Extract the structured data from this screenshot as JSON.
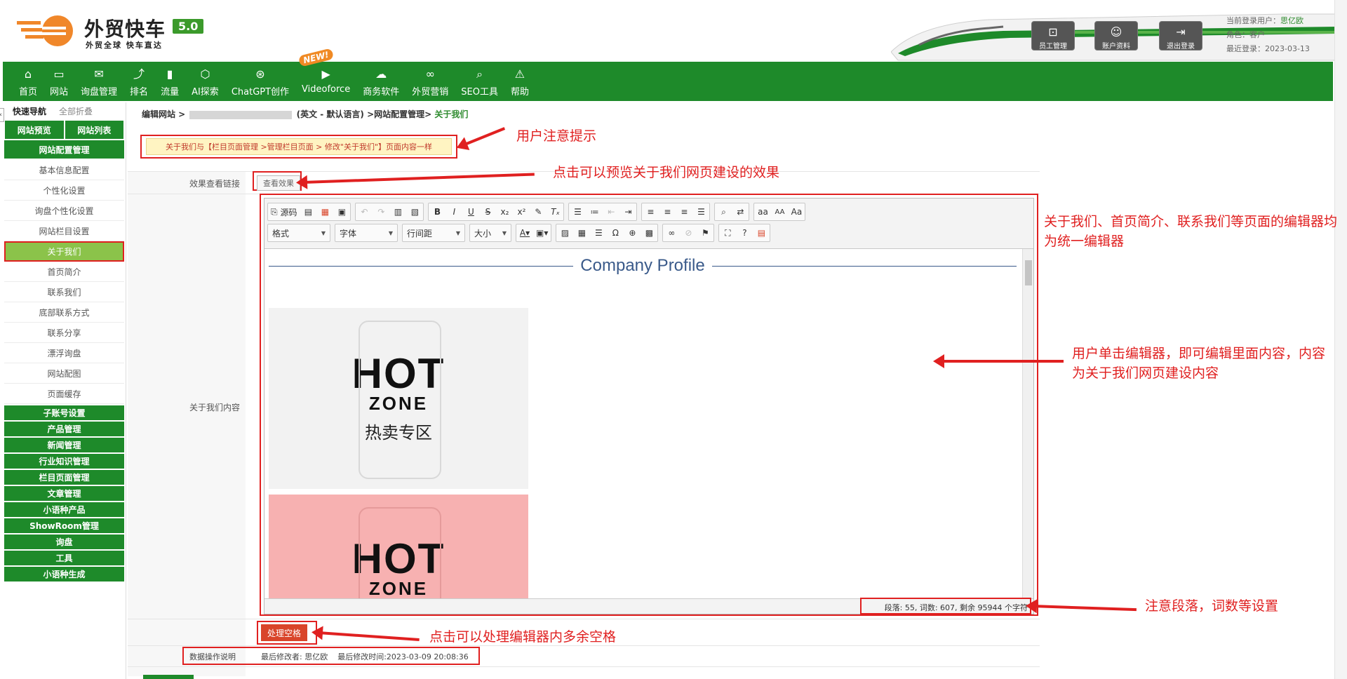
{
  "header": {
    "brand": "外贸快车",
    "version": "5.0",
    "slogan": "外贸全球 快车直达",
    "buttons": [
      {
        "label": "员工管理",
        "icon": "staff-icon"
      },
      {
        "label": "账户资料",
        "icon": "account-icon"
      },
      {
        "label": "退出登录",
        "icon": "logout-icon"
      }
    ],
    "user": {
      "current_label": "当前登录用户：",
      "current_name": "思亿欧",
      "role": "角色：客户",
      "last_login": "最近登录：2023-03-13"
    }
  },
  "nav": {
    "items": [
      {
        "label": "首页",
        "icon": "home-icon",
        "glyph": "⌂"
      },
      {
        "label": "网站",
        "icon": "monitor-icon",
        "glyph": "▭"
      },
      {
        "label": "询盘管理",
        "icon": "mail-icon",
        "glyph": "✉"
      },
      {
        "label": "排名",
        "icon": "ranking-icon",
        "glyph": "⤴"
      },
      {
        "label": "流量",
        "icon": "bar-chart-icon",
        "glyph": "▮"
      },
      {
        "label": "AI探索",
        "icon": "ai-icon",
        "glyph": "⬡"
      },
      {
        "label": "ChatGPT创作",
        "icon": "chatgpt-icon",
        "glyph": "⊛"
      },
      {
        "label": "Videoforce",
        "icon": "video-icon",
        "glyph": "▶"
      },
      {
        "label": "商务软件",
        "icon": "cloud-icon",
        "glyph": "☁"
      },
      {
        "label": "外贸营销",
        "icon": "marketing-icon",
        "glyph": "∞"
      },
      {
        "label": "SEO工具",
        "icon": "search-icon",
        "glyph": "⌕"
      },
      {
        "label": "帮助",
        "icon": "warning-icon",
        "glyph": "⚠"
      }
    ],
    "new_badge": "NEW!"
  },
  "sidebar": {
    "tab_quick": "快速导航",
    "tab_fold": "全部折叠",
    "preview": "网站预览",
    "list": "网站列表",
    "config_section": "网站配置管理",
    "sub_items": [
      "基本信息配置",
      "个性化设置",
      "询盘个性化设置",
      "网站栏目设置",
      "关于我们",
      "首页简介",
      "联系我们",
      "底部联系方式",
      "联系分享",
      "漂浮询盘",
      "网站配图",
      "页面缓存"
    ],
    "sections": [
      "子账号设置",
      "产品管理",
      "新闻管理",
      "行业知识管理",
      "栏目页面管理",
      "文章管理",
      "小语种产品",
      "ShowRoom管理",
      "询盘",
      "工具",
      "小语种生成"
    ]
  },
  "breadcrumb": {
    "prefix": "编辑网站 >",
    "lang": "(英文 - 默认语言) >网站配置管理>",
    "current": "关于我们"
  },
  "notice": "关于我们与【栏目页面管理 >管理栏目页面 > 修改\"关于我们\"】页面内容一样",
  "form": {
    "preview_label": "效果查看链接",
    "preview_btn": "查看效果",
    "content_label": "关于我们内容",
    "trim_btn": "处理空格",
    "data_label": "数据操作说明",
    "data_text": "最后修改者: 思亿欧    最后修改时间:2023-03-09 20:08:36"
  },
  "editor": {
    "source_label": "源码",
    "format": "格式",
    "font": "字体",
    "line_height": "行间距",
    "size": "大小",
    "profile_title": "Company Profile",
    "card_hot": "HOT",
    "card_zone": "ZONE",
    "card_cn": "热卖专区",
    "status": "段落: 55, 词数: 607, 剩余 95944 个字符"
  },
  "annotations": {
    "notice": "用户注意提示",
    "preview": "点击可以预览关于我们网页建设的效果",
    "editor_unified": "关于我们、首页简介、联系我们等页面的编辑器均为统一编辑器",
    "editor_click": "用户单击编辑器，即可编辑里面内容，内容为关于我们网页建设内容",
    "status": "注意段落，词数等设置",
    "trim": "点击可以处理编辑器内多余空格"
  },
  "colors": {
    "nav_green": "#1e8a2a",
    "active_green": "#8bc34a",
    "annotation_red": "#e02020",
    "title_blue": "#3a5a8a"
  }
}
